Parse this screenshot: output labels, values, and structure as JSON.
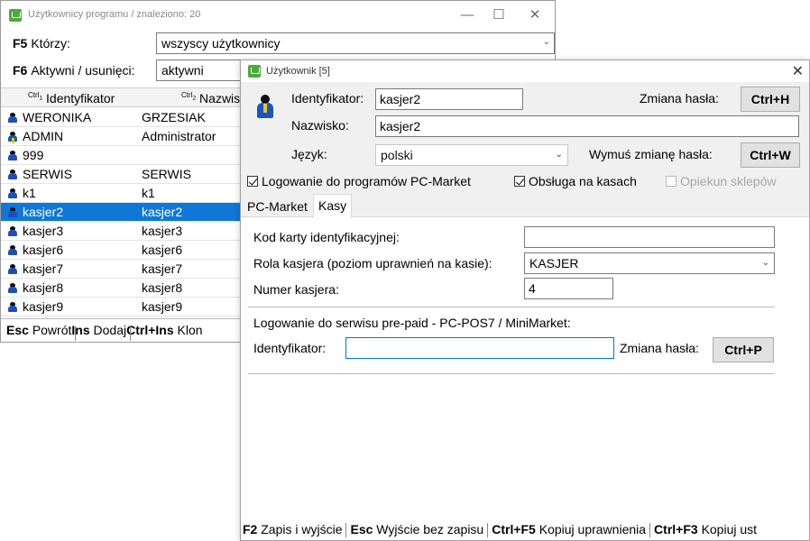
{
  "back_window": {
    "title": "Użytkownicy programu / znaleziono: 20",
    "filter_f5": {
      "key": "F5",
      "label": "Którzy:",
      "value": "wszyscy użytkownicy"
    },
    "filter_f6": {
      "key": "F6",
      "label": "Aktywni / usunięci:",
      "value": "aktywni"
    },
    "grid": {
      "headers": [
        {
          "ctrl": "Ctrl",
          "ctrl_num": "1",
          "label": "Identyfikator"
        },
        {
          "ctrl": "Ctrl",
          "ctrl_num": "2",
          "label": "Nazwis"
        }
      ],
      "rows": [
        {
          "id": "WERONIKA",
          "name": "GRZESIAK",
          "selected": false
        },
        {
          "id": "ADMIN",
          "name": "Administrator",
          "selected": false
        },
        {
          "id": "999",
          "name": "",
          "selected": false
        },
        {
          "id": "SERWIS",
          "name": "SERWIS",
          "selected": false
        },
        {
          "id": "k1",
          "name": "k1",
          "selected": false
        },
        {
          "id": "kasjer2",
          "name": "kasjer2",
          "selected": true
        },
        {
          "id": "kasjer3",
          "name": "kasjer3",
          "selected": false
        },
        {
          "id": "kasjer6",
          "name": "kasjer6",
          "selected": false
        },
        {
          "id": "kasjer7",
          "name": "kasjer7",
          "selected": false
        },
        {
          "id": "kasjer8",
          "name": "kasjer8",
          "selected": false
        },
        {
          "id": "kasjer9",
          "name": "kasjer9",
          "selected": false
        }
      ]
    },
    "footer": [
      {
        "key": "Esc",
        "label": "Powrót"
      },
      {
        "key": "Ins",
        "label": "Dodaj"
      },
      {
        "key": "Ctrl+Ins",
        "label": "Klon"
      }
    ]
  },
  "dialog": {
    "title": "Użytkownik [5]",
    "identyfikator": {
      "label": "Identyfikator:",
      "value": "kasjer2"
    },
    "nazwisko": {
      "label": "Nazwisko:",
      "value": "kasjer2"
    },
    "jezyk": {
      "label": "Język:",
      "value": "polski"
    },
    "zmiana_hasla": {
      "label": "Zmiana hasła:",
      "button": "Ctrl+H"
    },
    "wymus_zmiane": {
      "label": "Wymuś zmianę hasła:",
      "button": "Ctrl+W"
    },
    "checkboxes": [
      {
        "label": "Logowanie do programów PC-Market",
        "checked": true,
        "disabled": false
      },
      {
        "label": "Obsługa na kasach",
        "checked": true,
        "disabled": false
      },
      {
        "label": "Opiekun sklepów",
        "checked": false,
        "disabled": true
      }
    ],
    "tabs": [
      {
        "label": "PC-Market",
        "active": false
      },
      {
        "label": "Kasy",
        "active": true
      }
    ],
    "kasy": {
      "kod_karty": {
        "label": "Kod karty identyfikacyjnej:",
        "value": ""
      },
      "rola": {
        "label": "Rola kasjera (poziom uprawnień na kasie):",
        "value": "KASJER"
      },
      "numer": {
        "label": "Numer kasjera:",
        "value": "4"
      },
      "prepaid_heading": "Logowanie do serwisu pre-paid - PC-POS7 / MiniMarket:",
      "prepaid_id": {
        "label": "Identyfikator:",
        "value": ""
      },
      "prepaid_haslo": {
        "label": "Zmiana hasła:",
        "button": "Ctrl+P"
      }
    },
    "footer": [
      {
        "key": "F2",
        "label": "Zapis i wyjście"
      },
      {
        "key": "Esc",
        "label": "Wyjście bez zapisu"
      },
      {
        "key": "Ctrl+F5",
        "label": "Kopiuj uprawnienia"
      },
      {
        "key": "Ctrl+F3",
        "label": "Kopiuj ust"
      }
    ]
  },
  "colors": {
    "selection": "#0f78d7",
    "icon_green": "#4caa3c",
    "user_blue": "#1d4fb8"
  }
}
